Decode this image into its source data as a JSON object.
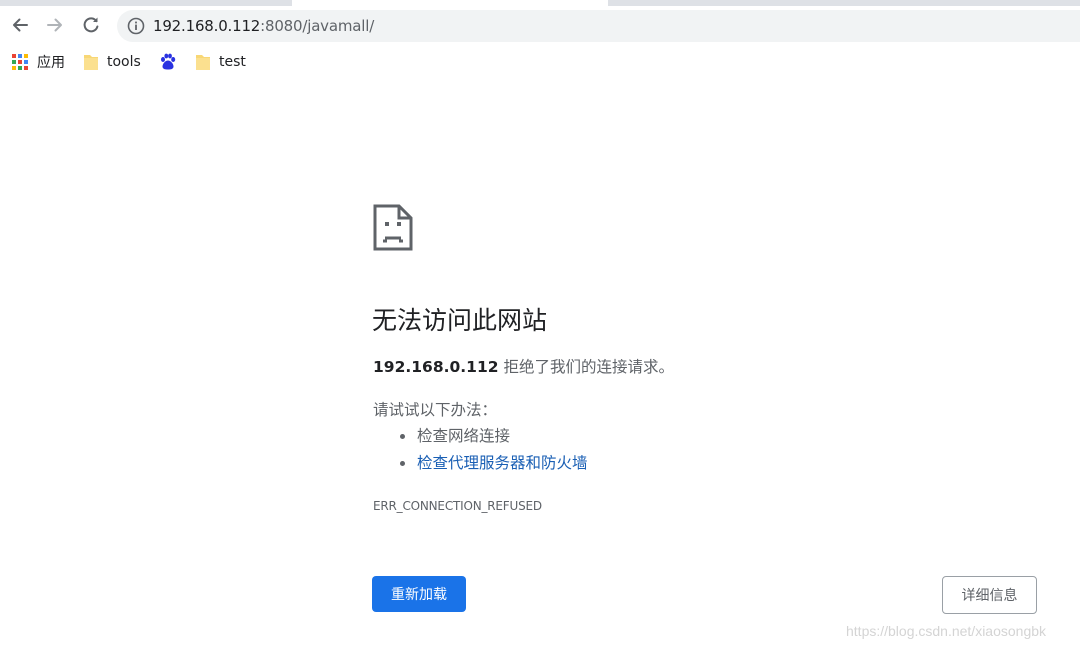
{
  "browser": {
    "address_bar": {
      "host": "192.168.0.112",
      "path": ":8080/javamall/"
    },
    "bookmarks": [
      {
        "label": "应用",
        "icon": "apps-grid-icon"
      },
      {
        "label": "tools",
        "icon": "folder-icon"
      },
      {
        "label": "",
        "icon": "baidu-paw-icon"
      },
      {
        "label": "test",
        "icon": "folder-icon"
      }
    ]
  },
  "error_page": {
    "icon": "sad-document-icon",
    "title": "无法访问此网站",
    "summary_host": "192.168.0.112",
    "summary_text": " 拒绝了我们的连接请求。",
    "suggestions_heading": "请试试以下办法：",
    "suggestions": [
      {
        "label": "检查网络连接"
      },
      {
        "label": "检查代理服务器和防火墙"
      }
    ],
    "error_code": "ERR_CONNECTION_REFUSED",
    "reload_label": "重新加载",
    "details_label": "详细信息"
  },
  "watermark": "https://blog.csdn.net/xiaosongbk",
  "colors": {
    "primary_button": "#1a73e8",
    "link": "#1a5fb4",
    "body_text": "#5f6368"
  }
}
